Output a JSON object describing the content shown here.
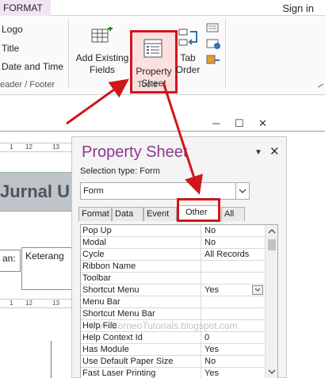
{
  "ribbon": {
    "tab_label": "FORMAT",
    "sign_in": "Sign in",
    "header_footer_items": [
      "Logo",
      "Title",
      "Date and Time"
    ],
    "header_footer_group": "eader / Footer",
    "add_existing_fields": [
      "Add Existing",
      "Fields"
    ],
    "property_sheet": [
      "Property",
      "Sheet"
    ],
    "tab_order": [
      "Tab",
      "Order"
    ],
    "tools_group": "Tools"
  },
  "form_design": {
    "title_text": "Jurnal U",
    "label_text": "an:",
    "field_text": "Keterang",
    "ruler_marks_top": [
      "1",
      "12",
      "13"
    ]
  },
  "property_sheet": {
    "title": "Property Sheet",
    "selection_type_label": "Selection type:",
    "selection_type_value": "Form",
    "object_selector": "Form",
    "tabs": [
      {
        "label": "Format",
        "active": false
      },
      {
        "label": "Data",
        "active": false
      },
      {
        "label": "Event",
        "active": false
      },
      {
        "label": "Other",
        "active": true
      },
      {
        "label": "All",
        "active": false
      }
    ],
    "rows": [
      {
        "name": "Pop Up",
        "value": "No"
      },
      {
        "name": "Modal",
        "value": "No"
      },
      {
        "name": "Cycle",
        "value": "All Records"
      },
      {
        "name": "Ribbon Name",
        "value": ""
      },
      {
        "name": "Toolbar",
        "value": ""
      },
      {
        "name": "Shortcut Menu",
        "value": "Yes"
      },
      {
        "name": "Menu Bar",
        "value": ""
      },
      {
        "name": "Shortcut Menu Bar",
        "value": ""
      },
      {
        "name": "Help File",
        "value": ""
      },
      {
        "name": "Help Context Id",
        "value": "0"
      },
      {
        "name": "Has Module",
        "value": "Yes"
      },
      {
        "name": "Use Default Paper Size",
        "value": "No"
      },
      {
        "name": "Fast Laser Printing",
        "value": "Yes"
      }
    ]
  },
  "watermark": "www.BorneoTutorials.blogspot.com",
  "colors": {
    "highlight": "#d0161c",
    "title": "#8a3a8d"
  }
}
